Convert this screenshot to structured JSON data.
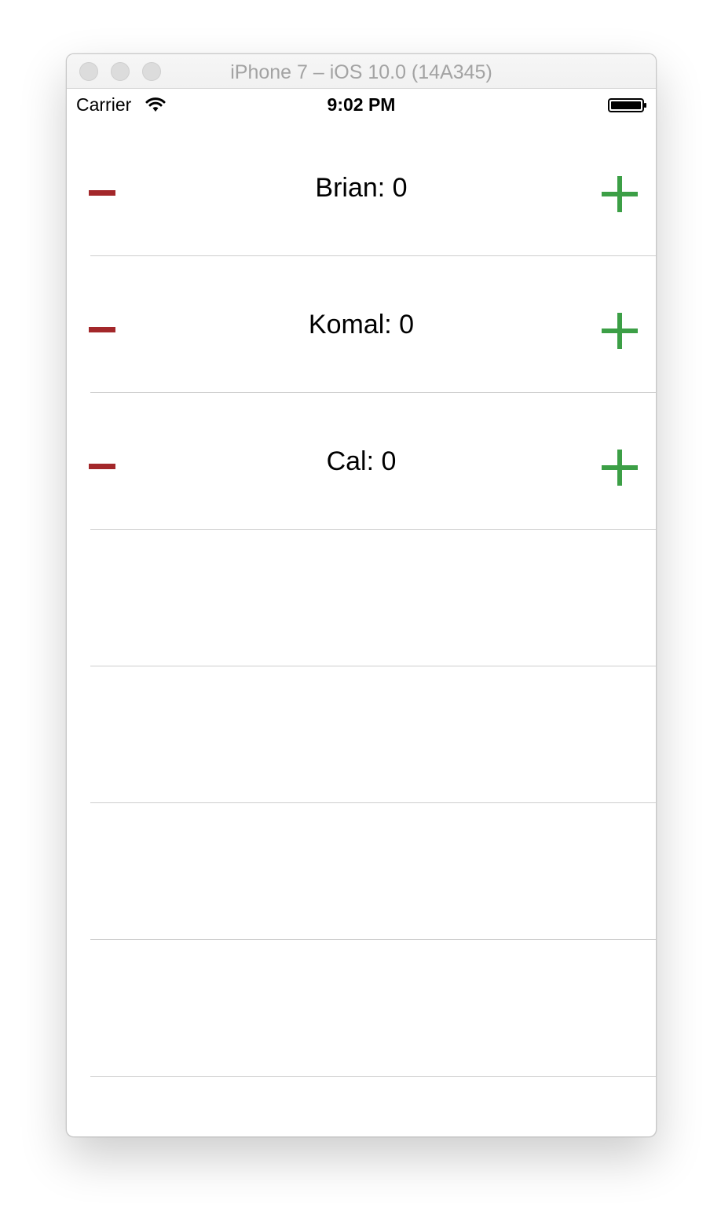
{
  "window": {
    "title": "iPhone 7 – iOS 10.0 (14A345)"
  },
  "status_bar": {
    "carrier": "Carrier",
    "time": "9:02 PM",
    "icons": [
      "wifi-icon",
      "battery-icon"
    ]
  },
  "players": [
    {
      "label": "Brian: 0"
    },
    {
      "label": "Komal: 0"
    },
    {
      "label": "Cal: 0"
    }
  ],
  "controls": {
    "decrement_icon": "minus-icon",
    "increment_icon": "plus-icon",
    "decrement_color": "#a3272a",
    "increment_color": "#3c9f46"
  }
}
